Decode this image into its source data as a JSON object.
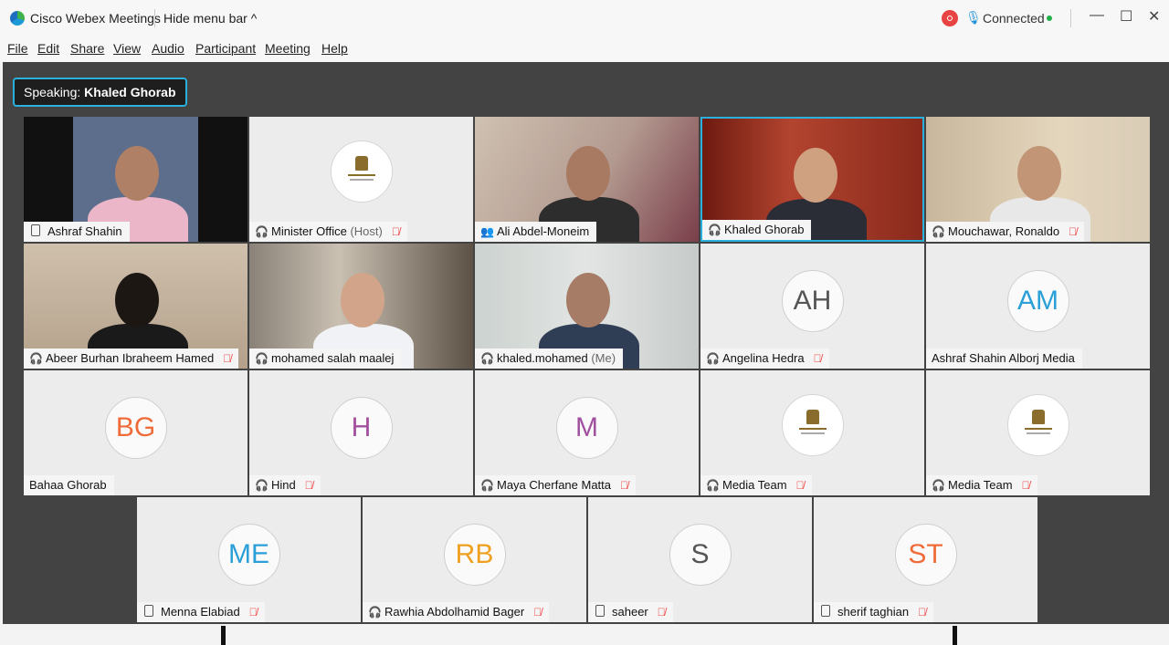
{
  "window": {
    "app_title": "Cisco Webex Meetings",
    "hide_menu": "Hide menu bar ^",
    "status": "Connected",
    "controls": {
      "minimize": "—",
      "maximize": "☐",
      "close": "✕"
    }
  },
  "menu": [
    "File",
    "Edit",
    "Share",
    "View",
    "Audio",
    "Participant",
    "Meeting",
    "Help"
  ],
  "speaking": {
    "prefix": "Speaking:",
    "name": "Khaled Ghorab"
  },
  "participants": [
    {
      "name": "Ashraf Shahin",
      "extra": "",
      "icon": "phone-icon",
      "muted": false,
      "tile": "video"
    },
    {
      "name": "Minister Office",
      "extra": "(Host)",
      "icon": "headset-icon",
      "muted": true,
      "tile": "emblem"
    },
    {
      "name": "Ali Abdel-Moneim",
      "extra": "",
      "icon": "people-icon",
      "muted": false,
      "tile": "video"
    },
    {
      "name": "Khaled Ghorab",
      "extra": "",
      "icon": "headset-icon",
      "muted": false,
      "tile": "video",
      "active": true
    },
    {
      "name": "Mouchawar, Ronaldo",
      "extra": "",
      "icon": "headset-icon",
      "muted": true,
      "tile": "video"
    },
    {
      "name": "Abeer Burhan Ibraheem Hamed",
      "extra": "",
      "icon": "headset-icon",
      "muted": true,
      "tile": "video"
    },
    {
      "name": "mohamed salah maalej",
      "extra": "",
      "icon": "headset-icon",
      "muted": false,
      "tile": "video"
    },
    {
      "name": "khaled.mohamed",
      "extra": "(Me)",
      "icon": "headset-icon",
      "muted": false,
      "tile": "video"
    },
    {
      "name": "Angelina Hedra",
      "extra": "",
      "icon": "headset-icon",
      "muted": true,
      "initials": "AH",
      "color": "#555555"
    },
    {
      "name": "Ashraf Shahin Alborj Media",
      "extra": "",
      "icon": "",
      "muted": false,
      "initials": "AM",
      "color": "#2a9fd8"
    },
    {
      "name": "Bahaa Ghorab",
      "extra": "",
      "icon": "",
      "muted": false,
      "initials": "BG",
      "color": "#ef6c3a"
    },
    {
      "name": "Hind",
      "extra": "",
      "icon": "headset-icon",
      "muted": true,
      "initials": "H",
      "color": "#a0509f"
    },
    {
      "name": "Maya Cherfane Matta",
      "extra": "",
      "icon": "headset-icon",
      "muted": true,
      "initials": "M",
      "color": "#a0509f"
    },
    {
      "name": "Media Team",
      "extra": "",
      "icon": "headset-icon",
      "muted": true,
      "tile": "emblem"
    },
    {
      "name": "Media Team",
      "extra": "",
      "icon": "headset-icon",
      "muted": true,
      "tile": "emblem"
    },
    {
      "name": "Menna Elabiad",
      "extra": "",
      "icon": "phone-icon",
      "muted": true,
      "initials": "ME",
      "color": "#2a9fd8"
    },
    {
      "name": "Rawhia Abdolhamid Bager",
      "extra": "",
      "icon": "headset-icon",
      "muted": true,
      "initials": "RB",
      "color": "#f0a020"
    },
    {
      "name": "saheer",
      "extra": "",
      "icon": "phone-icon",
      "muted": true,
      "initials": "S",
      "color": "#555555"
    },
    {
      "name": "sherif taghian",
      "extra": "",
      "icon": "phone-icon",
      "muted": true,
      "initials": "ST",
      "color": "#ef6c3a"
    }
  ]
}
